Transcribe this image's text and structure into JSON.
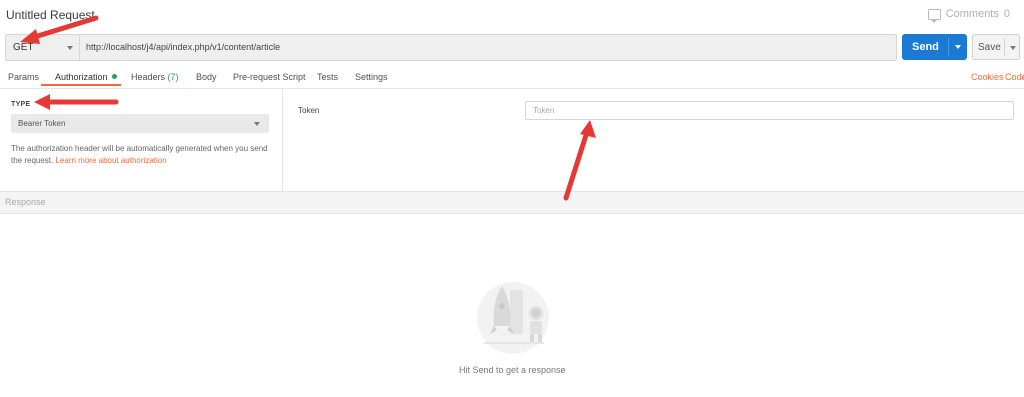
{
  "window": {
    "title": "Untitled Request",
    "comments_label": "Comments",
    "comments_count": "0"
  },
  "request": {
    "method": "GET",
    "url": "http://localhost/j4/api/index.php/v1/content/article",
    "send_label": "Send",
    "save_label": "Save"
  },
  "tabs": [
    {
      "label": "Params"
    },
    {
      "label": "Authorization"
    },
    {
      "label": "Headers",
      "count": "(7)"
    },
    {
      "label": "Body"
    },
    {
      "label": "Pre-request Script"
    },
    {
      "label": "Tests"
    },
    {
      "label": "Settings"
    }
  ],
  "links": {
    "cookies": "Cookies",
    "code": "Code"
  },
  "auth": {
    "type_label": "TYPE",
    "type_value": "Bearer Token",
    "description": "The authorization header will be automatically generated when you send the request.",
    "learn_more": "Learn more about authorization",
    "token_label": "Token",
    "token_placeholder": "Token"
  },
  "response": {
    "label": "Response",
    "hint": "Hit Send to get a response"
  },
  "colors": {
    "accent": "#f26b3a",
    "send": "#1a7ad4",
    "annotation": "#e53935",
    "status_dot": "#2e9e55"
  }
}
